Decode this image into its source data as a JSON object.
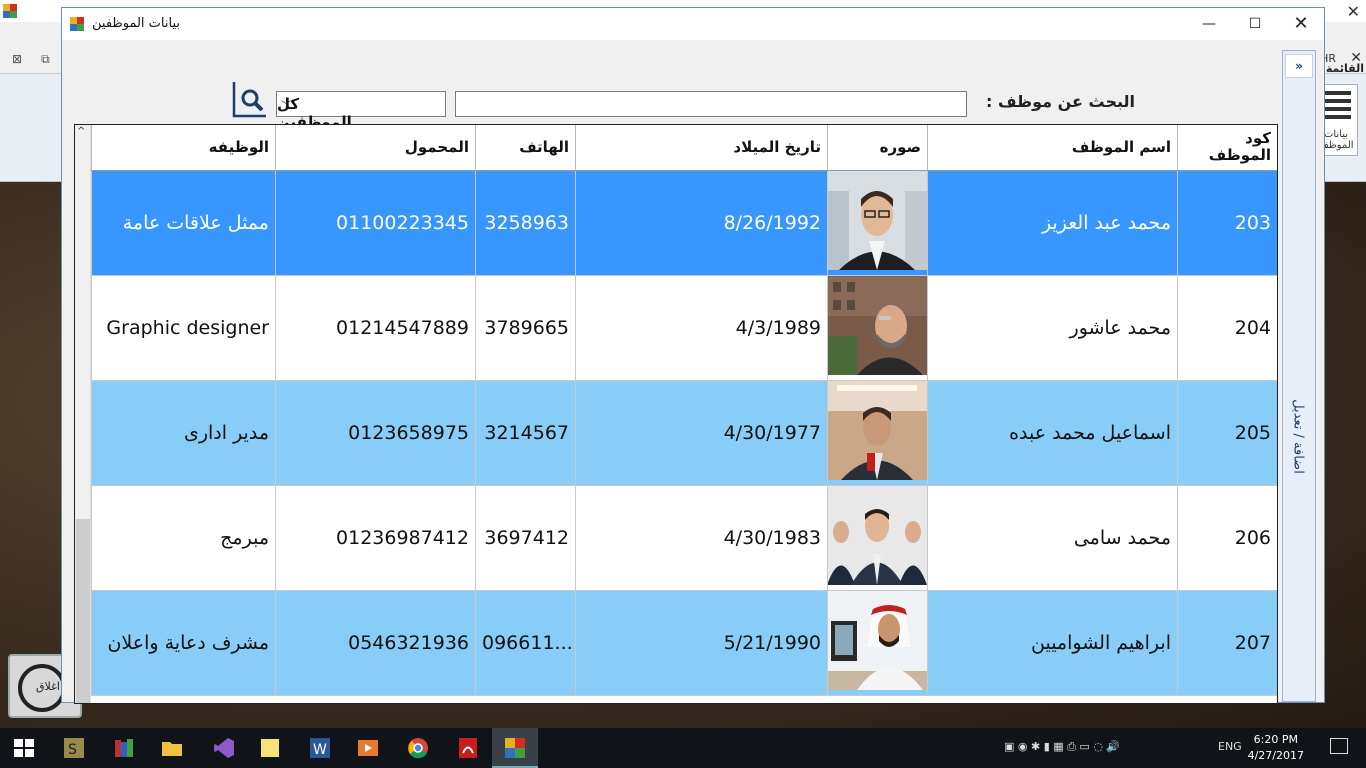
{
  "window": {
    "title": "بيانات الموظفين",
    "minimize_glyph": "—",
    "maximize_glyph": "☐",
    "close_glyph": "✕"
  },
  "background_app": {
    "ribbon_tab": "القائمة",
    "ribbon_button": "بيانات الموظف",
    "toolbar_hr": "HR",
    "close_label": "اغلاق"
  },
  "search": {
    "label": "البحث عن موظف :",
    "value": "",
    "filter_selected": "كل الموظفين",
    "search_icon": "search-icon"
  },
  "side_panel": {
    "collapse_glyph": "»",
    "label": "اضافة / تعديل"
  },
  "grid": {
    "columns": [
      "كود الموظف",
      "اسم الموظف",
      "صوره",
      "تاريخ الميلاد",
      "الهاتف",
      "المحمول",
      "الوظيفه"
    ],
    "rows": [
      {
        "code": "203",
        "name": "محمد عبد العزيز",
        "birth": "8/26/1992",
        "phone": "3258963",
        "mobile": "01100223345",
        "job": "ممثل علاقات عامة",
        "state": "selected"
      },
      {
        "code": "204",
        "name": "محمد عاشور",
        "birth": "4/3/1989",
        "phone": "3789665",
        "mobile": "01214547889",
        "job": "Graphic designer",
        "state": "normal"
      },
      {
        "code": "205",
        "name": "اسماعيل محمد عبده",
        "birth": "4/30/1977",
        "phone": "3214567",
        "mobile": "0123658975",
        "job": "مدير ادارى",
        "state": "alt"
      },
      {
        "code": "206",
        "name": "محمد سامى",
        "birth": "4/30/1983",
        "phone": "3697412",
        "mobile": "01236987412",
        "job": "مبرمج",
        "state": "normal"
      },
      {
        "code": "207",
        "name": "ابراهيم الشواميين",
        "birth": "5/21/1990",
        "phone": "096611...",
        "mobile": "0546321936",
        "job": "مشرف دعاية واعلان",
        "state": "alt"
      }
    ]
  },
  "taskbar": {
    "language": "ENG",
    "time": "6:20 PM",
    "date": "4/27/2017"
  },
  "colors": {
    "selected_row": "#3797ff",
    "alt_row": "#87cdf8",
    "side_panel_text": "#1f3c6e"
  }
}
